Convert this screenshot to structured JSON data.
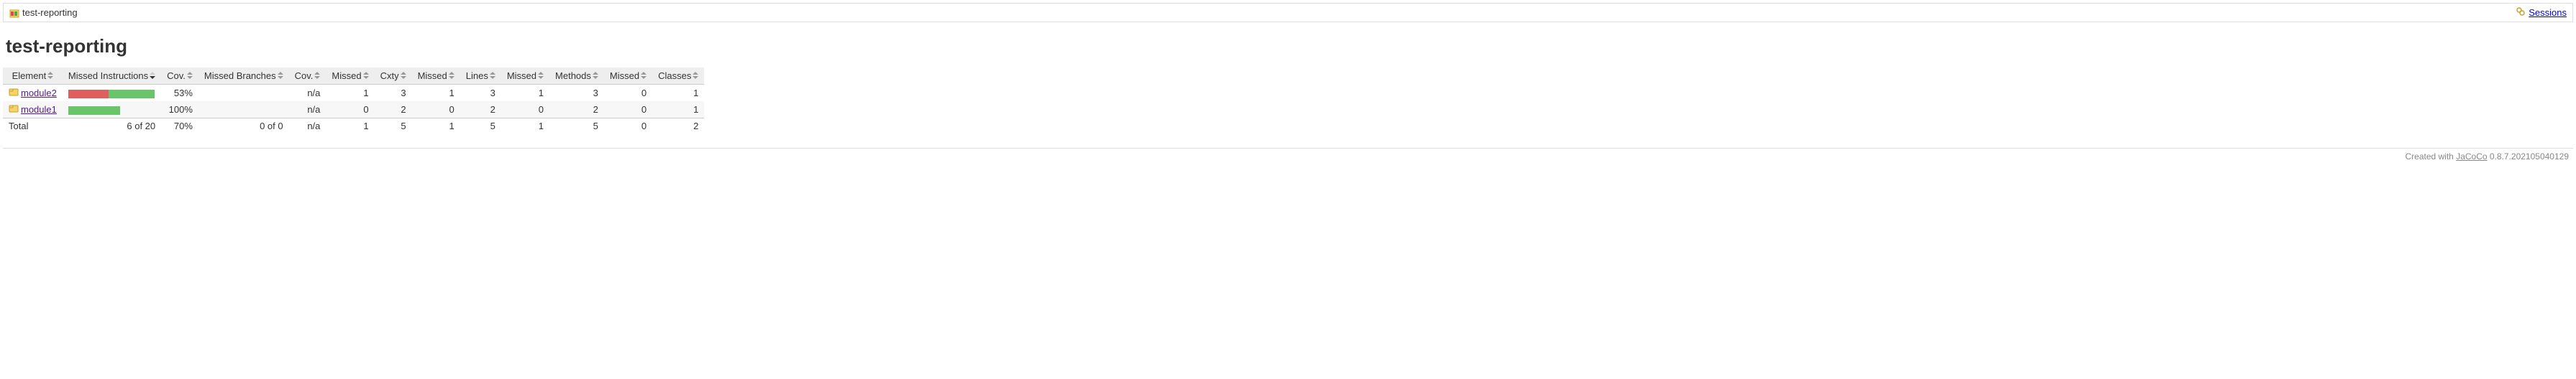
{
  "breadcrumb": {
    "title": "test-reporting",
    "sessions_label": "Sessions"
  },
  "page_title": "test-reporting",
  "headers": {
    "element": "Element",
    "missed_instr": "Missed Instructions",
    "cov1": "Cov.",
    "missed_branches": "Missed Branches",
    "cov2": "Cov.",
    "missed_cxty": "Missed",
    "cxty": "Cxty",
    "missed_lines": "Missed",
    "lines": "Lines",
    "missed_methods": "Missed",
    "methods": "Methods",
    "missed_classes": "Missed",
    "classes": "Classes"
  },
  "rows": [
    {
      "name": "module2",
      "bar": {
        "red_pct": 47,
        "green_pct": 53
      },
      "cov_instr": "53%",
      "missed_branches_bar": "",
      "cov_branches": "n/a",
      "missed_cxty": "1",
      "cxty": "3",
      "missed_lines": "1",
      "lines": "3",
      "missed_methods": "1",
      "methods": "3",
      "missed_classes": "0",
      "classes": "1"
    },
    {
      "name": "module1",
      "bar": {
        "red_pct": 0,
        "green_pct": 60
      },
      "cov_instr": "100%",
      "missed_branches_bar": "",
      "cov_branches": "n/a",
      "missed_cxty": "0",
      "cxty": "2",
      "missed_lines": "0",
      "lines": "2",
      "missed_methods": "0",
      "methods": "2",
      "missed_classes": "0",
      "classes": "1"
    }
  ],
  "total": {
    "label": "Total",
    "missed_instr": "6 of 20",
    "cov_instr": "70%",
    "missed_branches": "0 of 0",
    "cov_branches": "n/a",
    "missed_cxty": "1",
    "cxty": "5",
    "missed_lines": "1",
    "lines": "5",
    "missed_methods": "1",
    "methods": "5",
    "missed_classes": "0",
    "classes": "2"
  },
  "footer": {
    "prefix": "Created with ",
    "link": "JaCoCo",
    "version": " 0.8.7.202105040129"
  }
}
